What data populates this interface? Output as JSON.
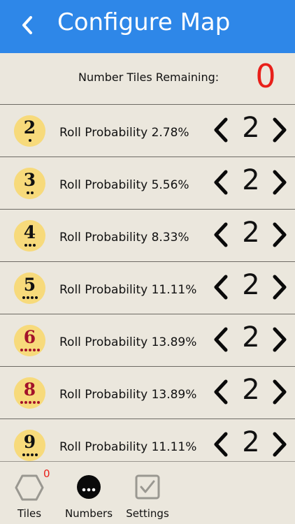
{
  "header": {
    "title": "Configure Map",
    "back_icon": "chevron-left-icon"
  },
  "remaining": {
    "label": "Number Tiles Remaining:",
    "value": "0"
  },
  "rows": [
    {
      "number": "2",
      "dots": 1,
      "color": "#111111",
      "probability": "Roll Probability 2.78%",
      "count": "2"
    },
    {
      "number": "3",
      "dots": 2,
      "color": "#111111",
      "probability": "Roll Probability 5.56%",
      "count": "2"
    },
    {
      "number": "4",
      "dots": 3,
      "color": "#111111",
      "probability": "Roll Probability 8.33%",
      "count": "2"
    },
    {
      "number": "5",
      "dots": 4,
      "color": "#111111",
      "probability": "Roll Probability 11.11%",
      "count": "2"
    },
    {
      "number": "6",
      "dots": 5,
      "color": "#a3122a",
      "probability": "Roll Probability 13.89%",
      "count": "2"
    },
    {
      "number": "8",
      "dots": 5,
      "color": "#a3122a",
      "probability": "Roll Probability 13.89%",
      "count": "2"
    },
    {
      "number": "9",
      "dots": 4,
      "color": "#111111",
      "probability": "Roll Probability 11.11%",
      "count": "2"
    }
  ],
  "tabs": {
    "tiles": {
      "label": "Tiles",
      "badge": "0",
      "icon": "hexagon-icon"
    },
    "numbers": {
      "label": "Numbers",
      "icon": "ellipsis-circle-icon"
    },
    "settings": {
      "label": "Settings",
      "icon": "checkbox-icon"
    }
  },
  "colors": {
    "header": "#2e87e8",
    "background": "#ebe7dd",
    "token": "#f7da7b",
    "remaining": "#e8201a"
  }
}
